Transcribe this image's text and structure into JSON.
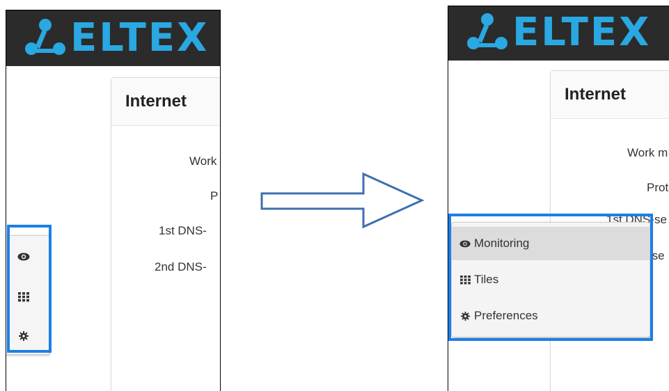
{
  "brand": {
    "logo_text": "ELTEX",
    "accent_color": "#29a8e1",
    "header_bg": "#2b2b2b",
    "highlight_color": "#1c7fe6"
  },
  "before": {
    "card_title": "Internet",
    "fields": [
      "Work",
      "P",
      "1st DNS-",
      "2nd DNS-"
    ],
    "toolbar_icons": [
      "eye-icon",
      "grid-icon",
      "gear-icon"
    ]
  },
  "after": {
    "card_title": "Internet",
    "fields": [
      "Work m",
      "Prot",
      "1st DNS-se",
      "-se"
    ],
    "menu": [
      {
        "label": "Monitoring",
        "icon": "eye-icon",
        "active": true
      },
      {
        "label": "Tiles",
        "icon": "grid-icon",
        "active": false
      },
      {
        "label": "Preferences",
        "icon": "gear-icon",
        "active": false
      }
    ]
  }
}
